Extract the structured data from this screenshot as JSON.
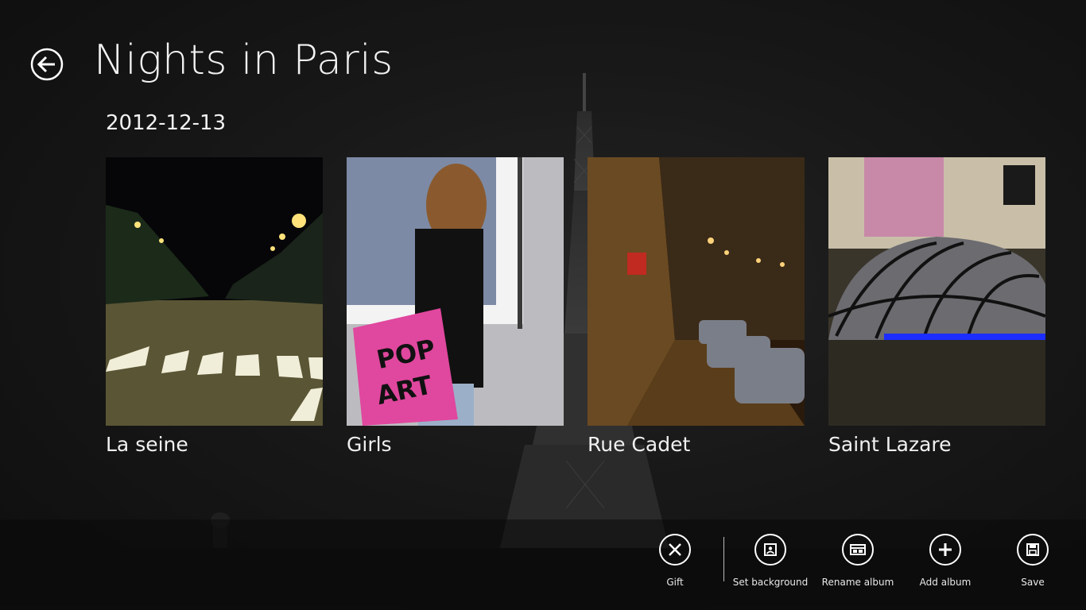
{
  "header": {
    "title": "Nights in Paris",
    "back_icon": "back-arrow-icon"
  },
  "group": {
    "date": "2012-12-13"
  },
  "photos": [
    {
      "caption": "La seine",
      "scene": "street-night"
    },
    {
      "caption": "Girls",
      "scene": "girl-pop-art"
    },
    {
      "caption": "Rue Cadet",
      "scene": "rue-cadet-night"
    },
    {
      "caption": "Saint Lazare",
      "scene": "saint-lazare-dome"
    }
  ],
  "appbar": {
    "buttons": [
      {
        "label": "Gift",
        "icon": "close-x-icon"
      },
      {
        "label": "Set background",
        "icon": "picture-icon"
      },
      {
        "label": "Rename album",
        "icon": "rename-icon"
      },
      {
        "label": "Add album",
        "icon": "add-icon"
      },
      {
        "label": "Save",
        "icon": "save-icon"
      }
    ]
  },
  "colors": {
    "background": "#141414",
    "text": "#f2f2f2",
    "pop_art_bag": "#e0479e"
  }
}
